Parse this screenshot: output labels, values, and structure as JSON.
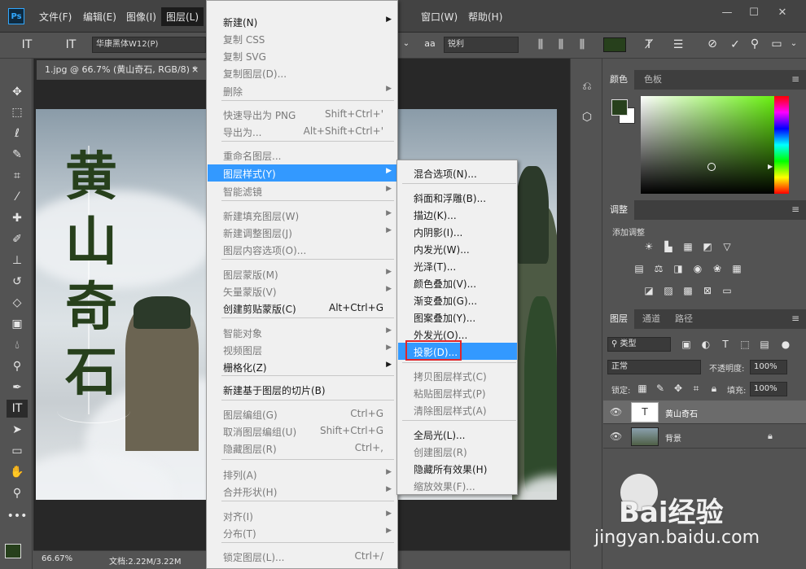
{
  "app": {
    "logo": "Ps"
  },
  "menubar": {
    "items": [
      "文件(F)",
      "编辑(E)",
      "图像(I)",
      "图层(L)",
      "窗口(W)",
      "帮助(H)"
    ],
    "window_controls": [
      "—",
      "☐",
      "✕"
    ]
  },
  "options": {
    "font_family": "华康黑体W12(P)",
    "antialias_icon": "aa",
    "antialias": "锐利"
  },
  "document": {
    "tab_title": "1.jpg @ 66.7% (黄山奇石, RGB/8) *",
    "tab_close": "×",
    "title_chars": [
      "黄",
      "山",
      "奇",
      "石"
    ]
  },
  "status": {
    "zoom": "66.67%",
    "doc_size": "文档:2.22M/3.22M"
  },
  "layer_menu": {
    "items": [
      {
        "label": "新建(N)",
        "shortcut": "",
        "arrow": true,
        "disabled": false
      },
      {
        "label": "复制 CSS",
        "shortcut": "",
        "arrow": false,
        "disabled": true
      },
      {
        "label": "复制 SVG",
        "shortcut": "",
        "arrow": false,
        "disabled": true
      },
      {
        "label": "复制图层(D)...",
        "shortcut": "",
        "arrow": false,
        "disabled": true
      },
      {
        "label": "删除",
        "shortcut": "",
        "arrow": true,
        "disabled": true
      },
      {
        "label": "快速导出为 PNG",
        "shortcut": "Shift+Ctrl+'",
        "arrow": false,
        "disabled": true
      },
      {
        "label": "导出为...",
        "shortcut": "Alt+Shift+Ctrl+'",
        "arrow": false,
        "disabled": true
      },
      {
        "label": "重命名图层...",
        "shortcut": "",
        "arrow": false,
        "disabled": true
      },
      {
        "label": "图层样式(Y)",
        "shortcut": "",
        "arrow": true,
        "disabled": false,
        "highlight": true
      },
      {
        "label": "智能滤镜",
        "shortcut": "",
        "arrow": true,
        "disabled": true
      },
      {
        "label": "新建填充图层(W)",
        "shortcut": "",
        "arrow": true,
        "disabled": true
      },
      {
        "label": "新建调整图层(J)",
        "shortcut": "",
        "arrow": true,
        "disabled": true
      },
      {
        "label": "图层内容选项(O)...",
        "shortcut": "",
        "arrow": false,
        "disabled": true
      },
      {
        "label": "图层蒙版(M)",
        "shortcut": "",
        "arrow": true,
        "disabled": true
      },
      {
        "label": "矢量蒙版(V)",
        "shortcut": "",
        "arrow": true,
        "disabled": true
      },
      {
        "label": "创建剪贴蒙版(C)",
        "shortcut": "Alt+Ctrl+G",
        "arrow": false,
        "disabled": false
      },
      {
        "label": "智能对象",
        "shortcut": "",
        "arrow": true,
        "disabled": true
      },
      {
        "label": "视频图层",
        "shortcut": "",
        "arrow": true,
        "disabled": true
      },
      {
        "label": "栅格化(Z)",
        "shortcut": "",
        "arrow": true,
        "disabled": false
      },
      {
        "label": "新建基于图层的切片(B)",
        "shortcut": "",
        "arrow": false,
        "disabled": false
      },
      {
        "label": "图层编组(G)",
        "shortcut": "Ctrl+G",
        "arrow": false,
        "disabled": true
      },
      {
        "label": "取消图层编组(U)",
        "shortcut": "Shift+Ctrl+G",
        "arrow": false,
        "disabled": true
      },
      {
        "label": "隐藏图层(R)",
        "shortcut": "Ctrl+,",
        "arrow": false,
        "disabled": true
      },
      {
        "label": "排列(A)",
        "shortcut": "",
        "arrow": true,
        "disabled": true
      },
      {
        "label": "合并形状(H)",
        "shortcut": "",
        "arrow": true,
        "disabled": true
      },
      {
        "label": "对齐(I)",
        "shortcut": "",
        "arrow": true,
        "disabled": true
      },
      {
        "label": "分布(T)",
        "shortcut": "",
        "arrow": true,
        "disabled": true
      },
      {
        "label": "锁定图层(L)...",
        "shortcut": "Ctrl+/",
        "arrow": false,
        "disabled": true
      }
    ]
  },
  "style_submenu": {
    "items": [
      {
        "label": "混合选项(N)...",
        "disabled": false
      },
      {
        "label": "斜面和浮雕(B)...",
        "disabled": false
      },
      {
        "label": "描边(K)...",
        "disabled": false
      },
      {
        "label": "内阴影(I)...",
        "disabled": false
      },
      {
        "label": "内发光(W)...",
        "disabled": false
      },
      {
        "label": "光泽(T)...",
        "disabled": false
      },
      {
        "label": "颜色叠加(V)...",
        "disabled": false
      },
      {
        "label": "渐变叠加(G)...",
        "disabled": false
      },
      {
        "label": "图案叠加(Y)...",
        "disabled": false
      },
      {
        "label": "外发光(O)...",
        "disabled": false
      },
      {
        "label": "投影(D)...",
        "disabled": false,
        "highlight": true
      },
      {
        "label": "拷贝图层样式(C)",
        "disabled": true
      },
      {
        "label": "粘贴图层样式(P)",
        "disabled": true
      },
      {
        "label": "清除图层样式(A)",
        "disabled": true
      },
      {
        "label": "全局光(L)...",
        "disabled": false
      },
      {
        "label": "创建图层(R)",
        "disabled": true
      },
      {
        "label": "隐藏所有效果(H)",
        "disabled": false
      },
      {
        "label": "缩放效果(F)...",
        "disabled": true
      }
    ]
  },
  "panels": {
    "color_tabs": [
      "颜色",
      "色板"
    ],
    "adjust_tab": "调整",
    "adjust_hint": "添加调整",
    "layers_tabs": [
      "图层",
      "通道",
      "路径"
    ],
    "filter_kind": "类型",
    "blend_mode": "正常",
    "opacity_label": "不透明度:",
    "opacity": "100%",
    "lock_label": "锁定:",
    "fill_label": "填充:",
    "fill": "100%",
    "layers": [
      {
        "name": "黄山奇石",
        "type": "text"
      },
      {
        "name": "背景",
        "type": "image"
      }
    ]
  },
  "colors": {
    "foreground": "#27401c",
    "highlight": "#3399ff",
    "redbox": "#e0262b"
  },
  "watermark": {
    "line1": "Bai经验",
    "line2": "jingyan.baidu.com"
  }
}
